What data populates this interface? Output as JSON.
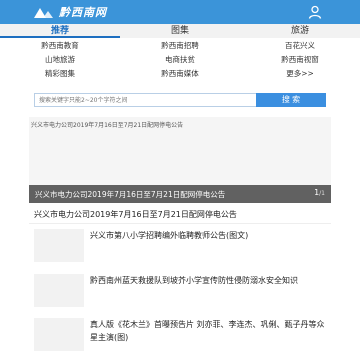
{
  "header": {
    "logo_text": "黔西南网",
    "brand_color": "#3b94d9"
  },
  "tabs": [
    {
      "label": "推荐",
      "active": true
    },
    {
      "label": "图集",
      "active": false
    },
    {
      "label": "旅游",
      "active": false
    }
  ],
  "links": [
    [
      "黔西南教育",
      "黔西南招聘",
      "百花兴义"
    ],
    [
      "山地旅游",
      "电商扶贫",
      "黔西南视窗"
    ],
    [
      "精彩图集",
      "黔西南媒体",
      "更多>>"
    ]
  ],
  "search": {
    "placeholder": "搜索关键字只能2~20个字符之间",
    "button_label": "搜 索"
  },
  "banner": {
    "top_text": "兴义市电力公司2019年7月16日至7月21日配网停电公告",
    "caption": "兴义市电力公司2019年7月16日至7月21日配网停电公告",
    "page_current": "1",
    "page_total": "/1"
  },
  "headline": "兴义市电力公司2019年7月16日至7月21日配网停电公告",
  "news": [
    {
      "title": "兴义市第八小学招聘编外临聘教师公告(图文)"
    },
    {
      "title": "黔西南州蓝天救援队到坡芥小学宣传防性侵防溺水安全知识"
    },
    {
      "title": "真人版《花木兰》首曝预告片 刘亦菲、李连杰、巩俐、甄子丹等众星主演(图)"
    }
  ]
}
